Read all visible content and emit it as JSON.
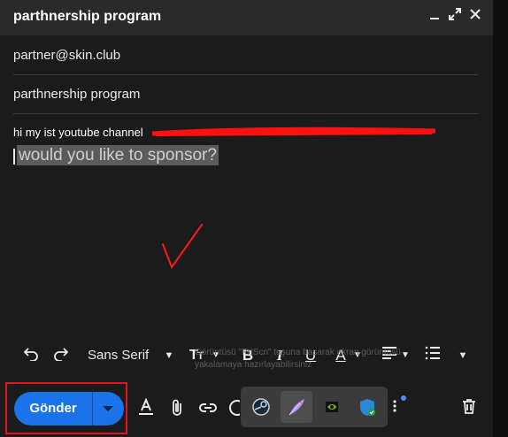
{
  "window": {
    "title": "parthnership program",
    "minimize_icon": "minimize-icon",
    "expand_icon": "expand-icon",
    "close_icon": "close-icon"
  },
  "recipient": {
    "value": "partner@skin.club"
  },
  "subject": {
    "value": "parthnership program"
  },
  "body": {
    "line1": "hi my ist youtube channel",
    "line2_selected": "would you like to sponsor?"
  },
  "formatting": {
    "undo_icon": "undo-icon",
    "redo_icon": "redo-icon",
    "font": "Sans Serif",
    "font_size_icon": "font-size-icon",
    "bold_label": "B",
    "italic_label": "I",
    "underline_label": "U",
    "text_color_label": "A",
    "align_icon": "align-left-icon",
    "list_icon": "numbered-list-icon",
    "more_icon": "more-formatting-icon"
  },
  "overlay_text": "Görüntüsü \"PrtScn\" tuşuna basarak ekran görüntüsü yakalamaya hazırlayabilirsiniz",
  "actions": {
    "send_label": "Gönder",
    "send_options_icon": "chevron-down-icon",
    "formatting_toggle_icon": "text-format-icon",
    "attach_icon": "attach-icon",
    "link_icon": "link-icon",
    "emoji_icon": "emoji-icon",
    "more_options_icon": "more-vert-icon",
    "delete_icon": "trash-icon"
  },
  "taskbar_tray": {
    "items": [
      "steam-icon",
      "feather-app-icon",
      "nvidia-icon",
      "defender-shield-icon"
    ]
  },
  "colors": {
    "send_blue": "#1a73e8",
    "annotation_red": "#e0141b"
  }
}
